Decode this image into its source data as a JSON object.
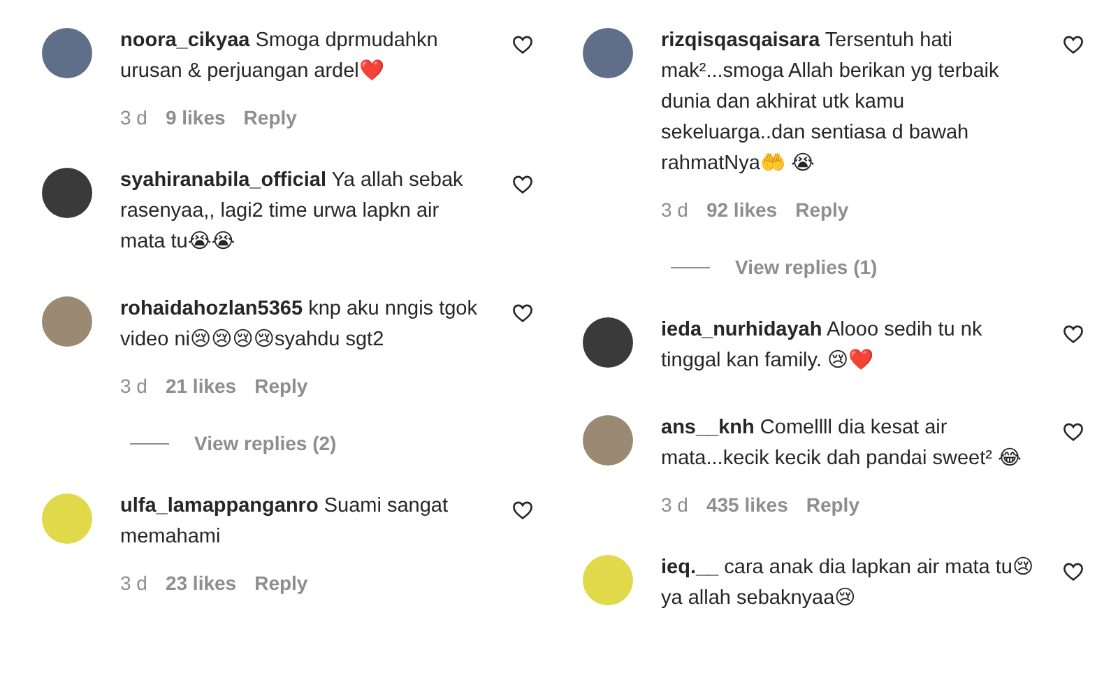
{
  "columns": [
    {
      "comments": [
        {
          "username": "noora_cikyaa",
          "text": "Smoga dprmudahkn urusan & perjuangan ardel❤️",
          "time": "3 d",
          "likes": "9 likes",
          "reply": "Reply",
          "liked": false
        },
        {
          "username": "syahiranabila_official",
          "text": "Ya allah sebak rasenyaa,, lagi2 time urwa lapkn air mata tu😭😭",
          "liked": false
        },
        {
          "username": "rohaidahozlan5365",
          "text": "knp aku nngis tgok video ni😢😢😢😢syahdu sgt2",
          "time": "3 d",
          "likes": "21 likes",
          "reply": "Reply",
          "view_replies": "View replies (2)",
          "liked": false
        },
        {
          "username": "ulfa_lamappanganro",
          "text": "Suami sangat memahami",
          "time": "3 d",
          "likes": "23 likes",
          "reply": "Reply",
          "liked": false
        }
      ]
    },
    {
      "comments": [
        {
          "username": "rizqisqasqaisara",
          "text": "Tersentuh hati mak²...smoga Allah berikan yg terbaik dunia dan akhirat utk kamu sekeluarga..dan sentiasa d bawah rahmatNya🤲 😭",
          "time": "3 d",
          "likes": "92 likes",
          "reply": "Reply",
          "view_replies": "View replies (1)",
          "liked": false
        },
        {
          "username": "ieda_nurhidayah",
          "text": "Alooo sedih tu nk tinggal kan family. 😢❤️",
          "liked": false
        },
        {
          "username": "ans__knh",
          "text": "Comellll dia kesat air mata...kecik kecik dah pandai sweet² 😂",
          "time": "3 d",
          "likes": "435 likes",
          "reply": "Reply",
          "liked": false
        },
        {
          "username": "ieq.__",
          "text": "cara anak dia lapkan air mata tu😢 ya allah sebaknyaa😢",
          "liked": false
        }
      ]
    }
  ]
}
